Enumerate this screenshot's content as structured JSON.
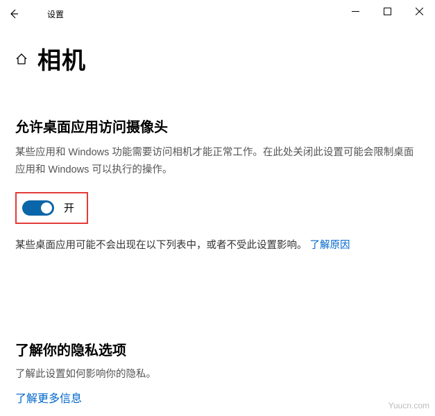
{
  "titlebar": {
    "app_title": "设置"
  },
  "header": {
    "page_title": "相机"
  },
  "camera_section": {
    "heading": "允许桌面应用访问摄像头",
    "description": "某些应用和 Windows 功能需要访问相机才能正常工作。在此处关闭此设置可能会限制桌面应用和 Windows 可以执行的操作。",
    "toggle_state_label": "开",
    "toggle_on": true,
    "sub_description": "某些桌面应用可能不会出现在以下列表中，或者不受此设置影响。",
    "learn_why_link": "了解原因"
  },
  "privacy_section": {
    "heading": "了解你的隐私选项",
    "description": "了解此设置如何影响你的隐私。",
    "learn_more_link": "了解更多信息"
  },
  "watermark": "Yuucn.com"
}
